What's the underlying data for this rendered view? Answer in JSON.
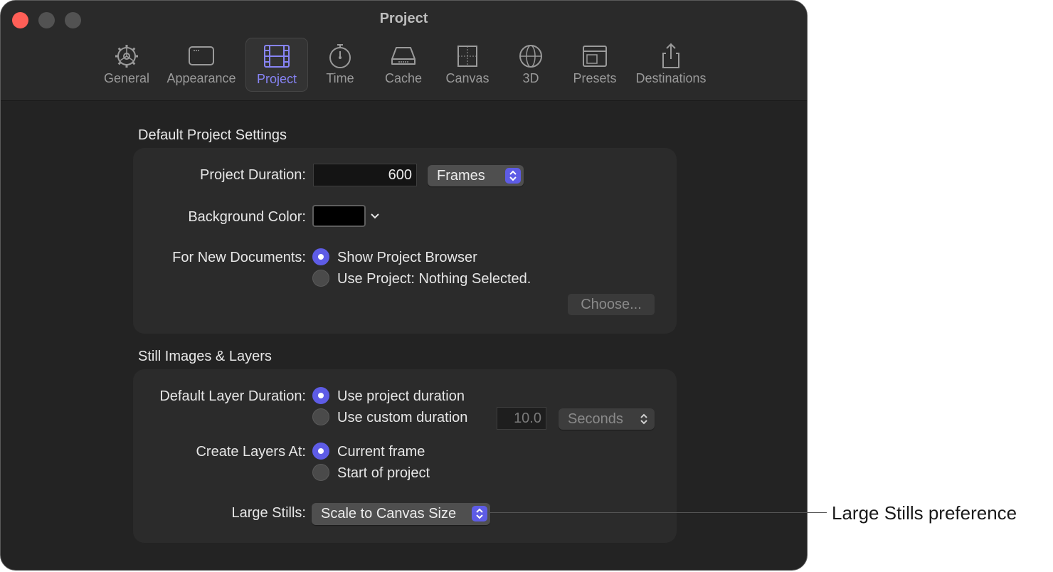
{
  "window": {
    "title": "Project",
    "controls": [
      "close",
      "minimize",
      "zoom"
    ]
  },
  "toolbar": {
    "items": [
      {
        "label": "General",
        "icon": "gear-icon",
        "selected": false
      },
      {
        "label": "Appearance",
        "icon": "window-icon",
        "selected": false
      },
      {
        "label": "Project",
        "icon": "film-icon",
        "selected": true
      },
      {
        "label": "Time",
        "icon": "stopwatch-icon",
        "selected": false
      },
      {
        "label": "Cache",
        "icon": "drive-icon",
        "selected": false
      },
      {
        "label": "Canvas",
        "icon": "canvas-icon",
        "selected": false
      },
      {
        "label": "3D",
        "icon": "sphere-icon",
        "selected": false
      },
      {
        "label": "Presets",
        "icon": "presets-icon",
        "selected": false
      },
      {
        "label": "Destinations",
        "icon": "share-icon",
        "selected": false
      }
    ]
  },
  "default_project_settings": {
    "title": "Default Project Settings",
    "project_duration": {
      "label": "Project Duration:",
      "value": "600",
      "unit": "Frames"
    },
    "background_color": {
      "label": "Background Color:",
      "color": "#000000"
    },
    "new_documents": {
      "label": "For New Documents:",
      "options": [
        {
          "label": "Show Project Browser",
          "selected": true
        },
        {
          "label": "Use Project: Nothing Selected.",
          "selected": false
        }
      ],
      "choose_button": "Choose..."
    }
  },
  "still_images_layers": {
    "title": "Still Images & Layers",
    "default_layer_duration": {
      "label": "Default Layer Duration:",
      "options": [
        {
          "label": "Use project duration",
          "selected": true
        },
        {
          "label": "Use custom duration",
          "selected": false
        }
      ],
      "custom_value": "10.0",
      "custom_unit": "Seconds"
    },
    "create_layers_at": {
      "label": "Create Layers At:",
      "options": [
        {
          "label": "Current frame",
          "selected": true
        },
        {
          "label": "Start of project",
          "selected": false
        }
      ]
    },
    "large_stills": {
      "label": "Large Stills:",
      "value": "Scale to Canvas Size"
    }
  },
  "callout": {
    "text": "Large Stills preference"
  },
  "colors": {
    "accent": "#5e5ce6",
    "selected_tab_text": "#8784f5",
    "close": "#ff5f57"
  }
}
